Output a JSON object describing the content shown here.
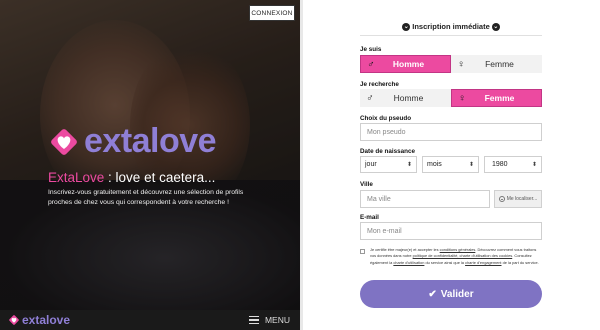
{
  "header": {
    "login_label": "CONNEXION"
  },
  "hero": {
    "brand_name": "extalove",
    "tagline_brand": "ExtaLove",
    "tagline_rest": " : love et caetera...",
    "intro": "Inscrivez-vous gratuitement et découvrez une sélection de profils proches de chez vous qui correspondent à votre recherche !"
  },
  "footer": {
    "brand_name": "extalove",
    "menu_label": "MENU"
  },
  "form": {
    "title": "Inscription immédiate",
    "i_am": {
      "label": "Je suis",
      "options": [
        {
          "symbol": "♂",
          "label": "Homme",
          "selected": true
        },
        {
          "symbol": "♀",
          "label": "Femme",
          "selected": false
        }
      ]
    },
    "looking_for": {
      "label": "Je recherche",
      "options": [
        {
          "symbol": "♂",
          "label": "Homme",
          "selected": false
        },
        {
          "symbol": "♀",
          "label": "Femme",
          "selected": true
        }
      ]
    },
    "username": {
      "label": "Choix du pseudo",
      "placeholder": "Mon pseudo"
    },
    "birthdate": {
      "label": "Date de naissance",
      "day": "jour",
      "month": "mois",
      "year": "1980"
    },
    "city": {
      "label": "Ville",
      "placeholder": "Ma ville",
      "locate_label": "Me localiser..."
    },
    "email": {
      "label": "E-mail",
      "placeholder": "Mon e-mail"
    },
    "consent": {
      "text_1": "Je certifie être majeur(e) et accepter les ",
      "link_1": "conditions générales",
      "text_2": ". Découvrez comment vous traitons vos données dans notre ",
      "link_2": "politique de confidentialité, charte d'utilisation des cookies",
      "text_3": ". Consultez également la ",
      "link_3": "charte d'utilisation",
      "text_4": " du service ainsi que la ",
      "link_4": "charte d'engagement",
      "text_5": " de la part du service."
    },
    "submit_label": "Valider"
  },
  "colors": {
    "pink": "#ec4aa0",
    "purple": "#7f73c3",
    "brand_purple": "#8f7fd6"
  }
}
